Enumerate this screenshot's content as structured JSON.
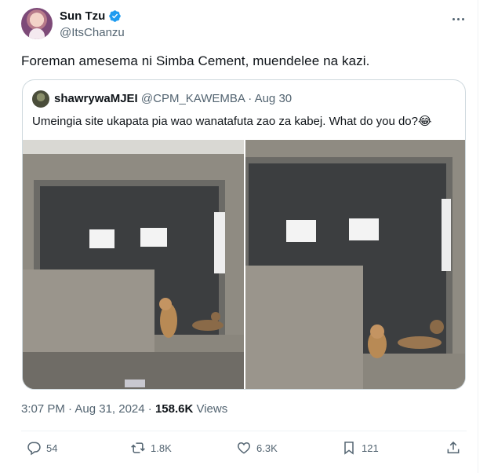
{
  "author": {
    "name": "Sun Tzu",
    "handle": "@ItsChanzu",
    "verified": true
  },
  "tweet": {
    "text": "Foreman amesema ni Simba Cement, muendelee na kazi."
  },
  "quoted": {
    "name": "shawrywaMJEI",
    "handle_date": "@CPM_KAWEMBA · Aug 30",
    "text": "Umeingia site ukapata pia wao wanatafuta zao za kabej. What do you do?😂"
  },
  "meta": {
    "time_date": "3:07 PM · Aug 31, 2024 · ",
    "views_count": "158.6K",
    "views_label": " Views"
  },
  "actions": {
    "replies": "54",
    "reposts": "1.8K",
    "likes": "6.3K",
    "bookmarks": "121"
  },
  "colors": {
    "text_primary": "#0f1419",
    "text_secondary": "#536471",
    "verified_blue": "#1d9bf0",
    "border": "#cfd9de"
  },
  "icons": [
    "verified-badge-icon",
    "more-options-icon",
    "reply-icon",
    "repost-icon",
    "like-icon",
    "bookmark-icon",
    "share-icon"
  ]
}
